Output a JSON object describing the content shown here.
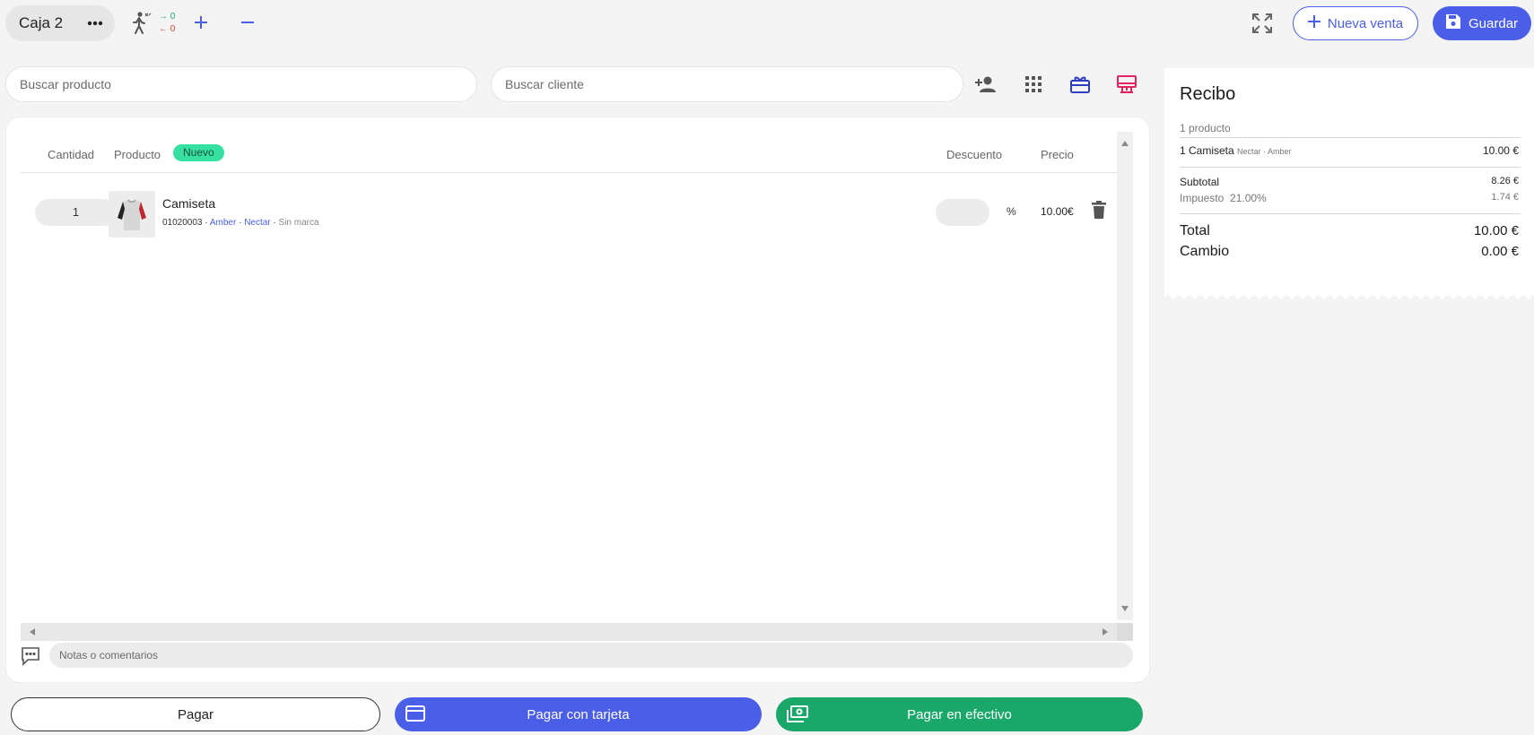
{
  "header": {
    "register_name": "Caja 2",
    "customers_in": "→ 0",
    "customers_out": "← 0",
    "new_sale_label": "Nueva venta",
    "save_label": "Guardar"
  },
  "search": {
    "product_placeholder": "Buscar producto",
    "client_placeholder": "Buscar cliente"
  },
  "toolbar_icons": [
    "add-customer-icon",
    "grid-icon",
    "gift-card-icon",
    "cash-register-icon"
  ],
  "table": {
    "headers": {
      "quantity": "Cantidad",
      "product": "Producto",
      "new_badge": "Nuevo",
      "discount": "Descuento",
      "price": "Precio"
    },
    "rows": [
      {
        "quantity": "1",
        "name": "Camiseta",
        "code": "01020003",
        "variant1": "Amber",
        "variant2": "Nectar",
        "brand": "Sin marca",
        "discount": "",
        "discount_unit": "%",
        "price": "10.00€"
      }
    ]
  },
  "notes": {
    "placeholder": "Notas o comentarios"
  },
  "receipt": {
    "title": "Recibo",
    "count": "1 producto",
    "item": "1 Camiseta",
    "item_detail": "Nectar · Amber",
    "item_price": "10.00 €",
    "subtotal_label": "Subtotal",
    "subtotal_value": "8.26 €",
    "tax_label": "Impuesto  21.00%",
    "tax_value": "1.74 €",
    "total_label": "Total",
    "total_value": "10.00 €",
    "change_label": "Cambio",
    "change_value": "0.00 €"
  },
  "actions": {
    "pay": "Pagar",
    "pay_card": "Pagar con tarjeta",
    "pay_cash": "Pagar en efectivo"
  },
  "colors": {
    "accent_blue": "#4b5ee8",
    "accent_green": "#1aa86a",
    "badge_green": "#36e0a0",
    "accent_pink": "#e0245e"
  }
}
